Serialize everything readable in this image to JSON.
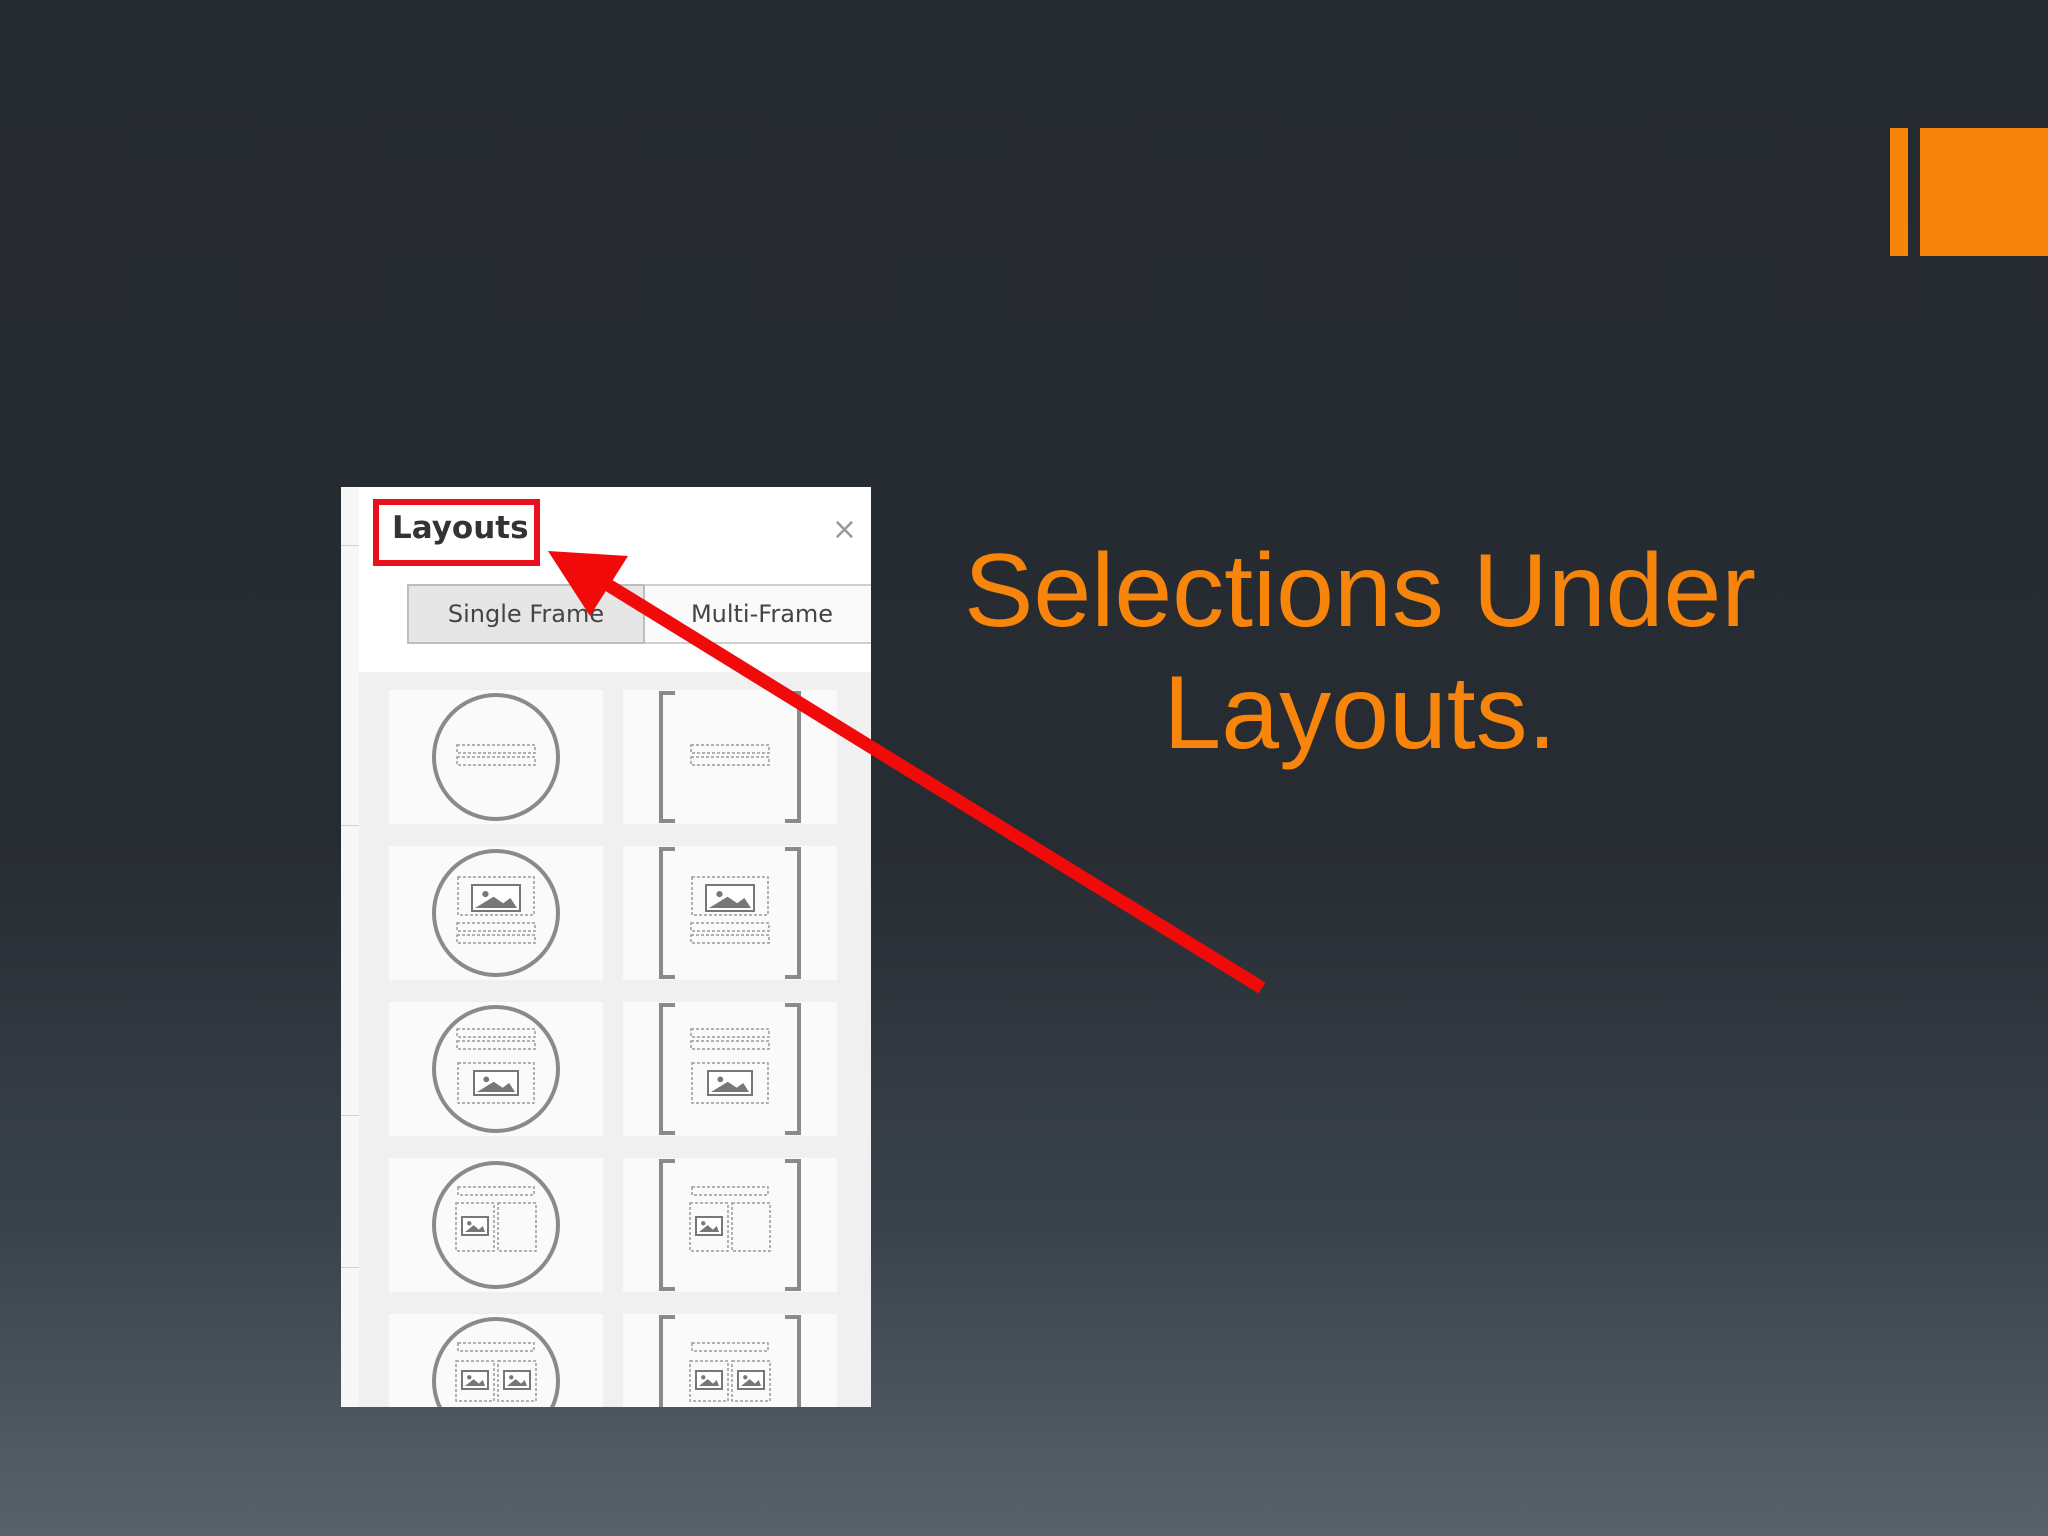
{
  "slide": {
    "title": "Selections Under Layouts."
  },
  "panel": {
    "title": "Layouts",
    "close_glyph": "×",
    "tabs": [
      {
        "label": "Single Frame",
        "active": true
      },
      {
        "label": "Multi-Frame",
        "active": false
      }
    ]
  },
  "colors": {
    "accent": "#f7840b",
    "highlight": "#e8101c"
  },
  "layout_options": [
    {
      "shape": "circle",
      "variant": "text-only"
    },
    {
      "shape": "bracket",
      "variant": "text-only"
    },
    {
      "shape": "circle",
      "variant": "image-over-text"
    },
    {
      "shape": "bracket",
      "variant": "image-over-text"
    },
    {
      "shape": "circle",
      "variant": "text-over-image"
    },
    {
      "shape": "bracket",
      "variant": "text-over-image"
    },
    {
      "shape": "circle",
      "variant": "text-over-image-and-box"
    },
    {
      "shape": "bracket",
      "variant": "text-over-image-and-box"
    },
    {
      "shape": "circle",
      "variant": "text-over-two-images"
    },
    {
      "shape": "bracket",
      "variant": "text-over-two-images"
    }
  ]
}
